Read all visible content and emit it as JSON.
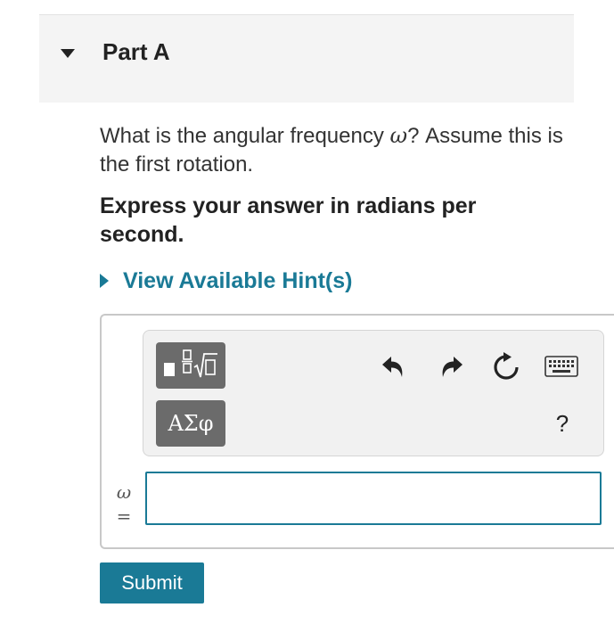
{
  "part": {
    "title": "Part A"
  },
  "question": {
    "text_before": "What is the angular frequency ",
    "symbol": "ω",
    "text_after": "? Assume this is the first rotation."
  },
  "instruction": "Express your answer in radians per second.",
  "hint": {
    "label": "View Available Hint(s)"
  },
  "toolbar": {
    "templates_icon": "templates-icon",
    "symbols_label": "ΑΣφ",
    "help_label": "?"
  },
  "answer": {
    "variable": "ω",
    "equals": "=",
    "value": "",
    "placeholder": ""
  },
  "submit": {
    "label": "Submit"
  },
  "colors": {
    "accent": "#1a7a96",
    "header_bg": "#f4f4f4",
    "tool_button": "#6b6b6b"
  }
}
